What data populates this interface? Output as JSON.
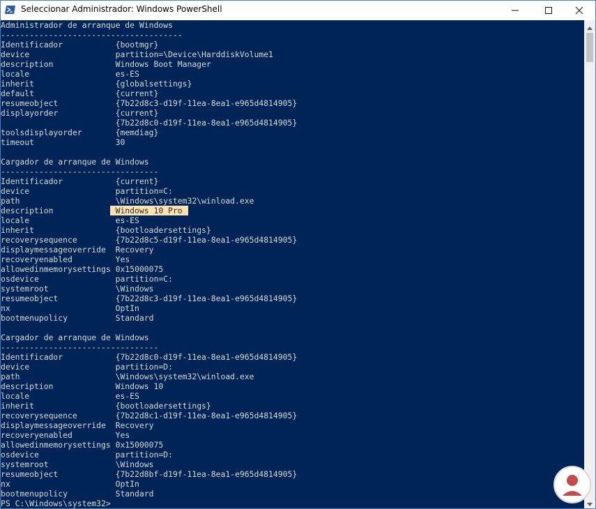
{
  "window": {
    "title": "Seleccionar Administrador: Windows PowerShell"
  },
  "icons": {
    "app": "powershell-icon",
    "minimize": "minimize-icon",
    "maximize": "maximize-icon",
    "close": "close-icon",
    "scroll_up": "chevron-up-icon",
    "scroll_down": "chevron-down-icon"
  },
  "colors": {
    "console_background": "#012456",
    "console_text": "#d9d9d9",
    "selection_highlight": "#fde3b3"
  },
  "console": {
    "lines": [
      [
        "Administrador de arranque de Windows",
        "",
        ""
      ],
      [
        "--------------------------------------",
        "",
        ""
      ],
      [
        "Identificador",
        "{bootmgr}",
        ""
      ],
      [
        "device",
        "partition=\\Device\\HarddiskVolume1",
        ""
      ],
      [
        "description",
        "Windows Boot Manager",
        ""
      ],
      [
        "locale",
        "es-ES",
        ""
      ],
      [
        "inherit",
        "{globalsettings}",
        ""
      ],
      [
        "default",
        "{current}",
        ""
      ],
      [
        "resumeobject",
        "{7b22d8c3-d19f-11ea-8ea1-e965d4814905}",
        ""
      ],
      [
        "displayorder",
        "{current}",
        ""
      ],
      [
        "",
        "{7b22d8c0-d19f-11ea-8ea1-e965d4814905}",
        ""
      ],
      [
        "toolsdisplayorder",
        "{memdiag}",
        ""
      ],
      [
        "timeout",
        "30",
        ""
      ],
      [
        "",
        "",
        ""
      ],
      [
        "Cargador de arranque de Windows",
        "",
        ""
      ],
      [
        "---------------------------------",
        "",
        ""
      ],
      [
        "Identificador",
        "{current}",
        ""
      ],
      [
        "device",
        "partition=C:",
        ""
      ],
      [
        "path",
        "\\Windows\\system32\\winload.exe",
        ""
      ],
      [
        "description",
        "",
        "Windows 10 Pro"
      ],
      [
        "locale",
        "es-ES",
        ""
      ],
      [
        "inherit",
        "{bootloadersettings}",
        ""
      ],
      [
        "recoverysequence",
        "{7b22d8c5-d19f-11ea-8ea1-e965d4814905}",
        ""
      ],
      [
        "displaymessageoverride",
        "Recovery",
        ""
      ],
      [
        "recoveryenabled",
        "Yes",
        ""
      ],
      [
        "allowedinmemorysettings",
        "0x15000075",
        ""
      ],
      [
        "osdevice",
        "partition=C:",
        ""
      ],
      [
        "systemroot",
        "\\Windows",
        ""
      ],
      [
        "resumeobject",
        "{7b22d8c3-d19f-11ea-8ea1-e965d4814905}",
        ""
      ],
      [
        "nx",
        "OptIn",
        ""
      ],
      [
        "bootmenupolicy",
        "Standard",
        ""
      ],
      [
        "",
        "",
        ""
      ],
      [
        "Cargador de arranque de Windows",
        "",
        ""
      ],
      [
        "---------------------------------",
        "",
        ""
      ],
      [
        "Identificador",
        "{7b22d8c0-d19f-11ea-8ea1-e965d4814905}",
        ""
      ],
      [
        "device",
        "partition=D:",
        ""
      ],
      [
        "path",
        "\\Windows\\system32\\winload.exe",
        ""
      ],
      [
        "description",
        "Windows 10",
        ""
      ],
      [
        "locale",
        "es-ES",
        ""
      ],
      [
        "inherit",
        "{bootloadersettings}",
        ""
      ],
      [
        "recoverysequence",
        "{7b22d8c1-d19f-11ea-8ea1-e965d4814905}",
        ""
      ],
      [
        "displaymessageoverride",
        "Recovery",
        ""
      ],
      [
        "recoveryenabled",
        "Yes",
        ""
      ],
      [
        "allowedinmemorysettings",
        "0x15000075",
        ""
      ],
      [
        "osdevice",
        "partition=D:",
        ""
      ],
      [
        "systemroot",
        "\\Windows",
        ""
      ],
      [
        "resumeobject",
        "{7b22d8bf-d19f-11ea-8ea1-e965d4814905}",
        ""
      ],
      [
        "nx",
        "OptIn",
        ""
      ],
      [
        "bootmenupolicy",
        "Standard",
        ""
      ],
      [
        "PS C:\\Windows\\system32>",
        "",
        ""
      ]
    ]
  }
}
